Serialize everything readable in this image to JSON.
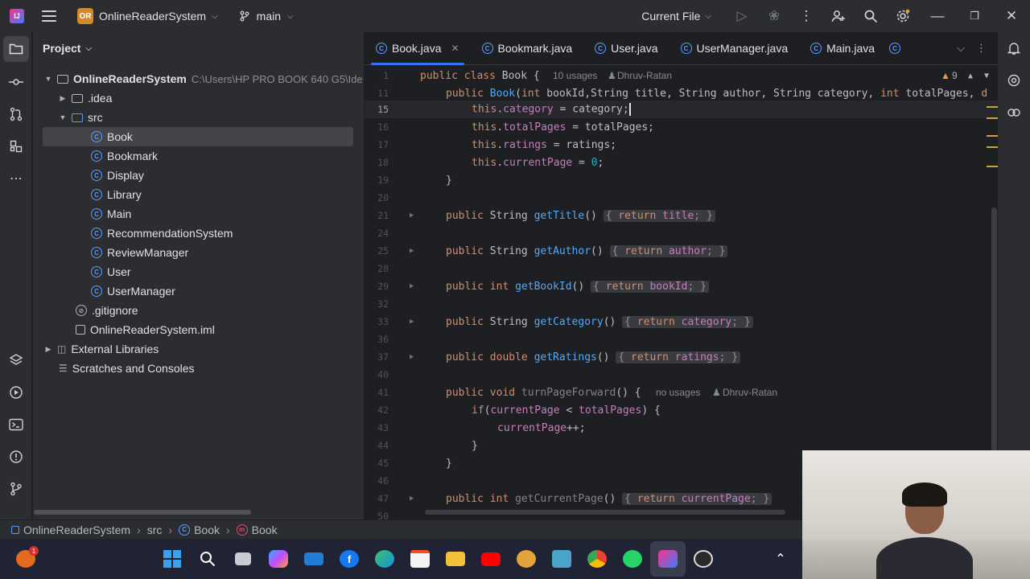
{
  "titlebar": {
    "project_badge": "OR",
    "project_name": "OnlineReaderSystem",
    "branch": "main",
    "run_config": "Current File"
  },
  "project_panel": {
    "title": "Project",
    "root_name": "OnlineReaderSystem",
    "root_path": "C:\\Users\\HP PRO BOOK 640 G5\\Ide",
    "idea": ".idea",
    "src": "src",
    "classes": [
      "Book",
      "Bookmark",
      "Display",
      "Library",
      "Main",
      "RecommendationSystem",
      "ReviewManager",
      "User",
      "UserManager"
    ],
    "gitignore": ".gitignore",
    "iml": "OnlineReaderSystem.iml",
    "external_libraries": "External Libraries",
    "scratches": "Scratches and Consoles"
  },
  "tabs": [
    "Book.java",
    "Bookmark.java",
    "User.java",
    "UserManager.java",
    "Main.java"
  ],
  "editor": {
    "line_numbers": [
      "1",
      "11",
      "15",
      "16",
      "17",
      "18",
      "19",
      "20",
      "21",
      "24",
      "25",
      "28",
      "29",
      "32",
      "33",
      "36",
      "37",
      "40",
      "41",
      "42",
      "43",
      "44",
      "45",
      "46",
      "47",
      "50"
    ],
    "usages": "10 usages",
    "author": "Dhruv-Ratan",
    "no_usages": "no usages",
    "warnings": "9"
  },
  "breadcrumbs": [
    "OnlineReaderSystem",
    "src",
    "Book",
    "Book"
  ]
}
